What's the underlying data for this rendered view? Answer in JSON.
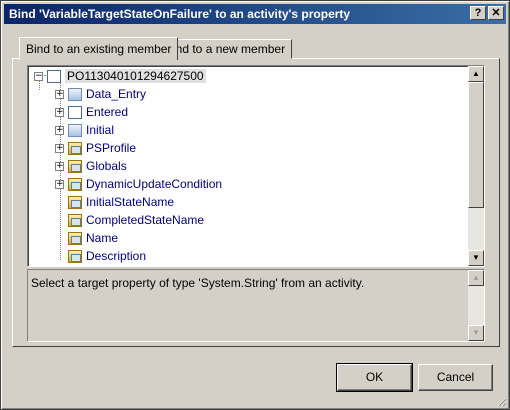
{
  "window": {
    "title": "Bind 'VariableTargetStateOnFailure' to an activity's property"
  },
  "titlebar_buttons": {
    "help": "?",
    "close": "✕"
  },
  "tabs": [
    {
      "label": "Bind to an existing member",
      "active": true
    },
    {
      "label": "Bind to a new member",
      "active": false
    }
  ],
  "tree": {
    "root": {
      "label": "PO113040101294627500",
      "expander": "−"
    },
    "items": [
      {
        "label": "Data_Entry",
        "icon": "activity-icon",
        "expander": "+"
      },
      {
        "label": "Entered",
        "icon": "state-icon",
        "expander": "+"
      },
      {
        "label": "Initial",
        "icon": "activity-icon",
        "expander": "+"
      },
      {
        "label": "PSProfile",
        "icon": "property-icon",
        "expander": "+"
      },
      {
        "label": "Globals",
        "icon": "property-icon",
        "expander": "+"
      },
      {
        "label": "DynamicUpdateCondition",
        "icon": "property-icon",
        "expander": "+"
      },
      {
        "label": "InitialStateName",
        "icon": "property-icon",
        "expander": ""
      },
      {
        "label": "CompletedStateName",
        "icon": "property-icon",
        "expander": ""
      },
      {
        "label": "Name",
        "icon": "property-icon",
        "expander": ""
      },
      {
        "label": "Description",
        "icon": "property-icon",
        "expander": ""
      }
    ]
  },
  "description": {
    "text": "Select a target property of type 'System.String' from an activity."
  },
  "scroll_arrows": {
    "up": "▲",
    "down": "▼"
  },
  "buttons": {
    "ok": "OK",
    "cancel": "Cancel"
  }
}
